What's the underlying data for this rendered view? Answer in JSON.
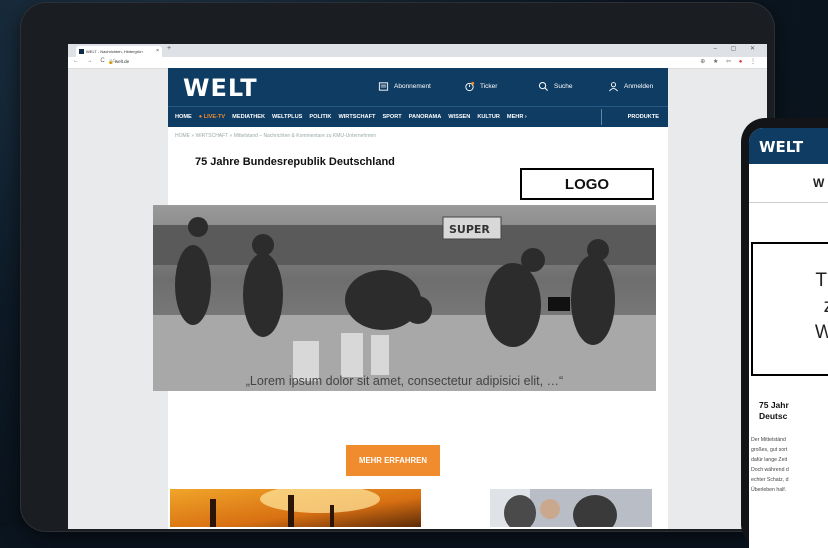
{
  "browser": {
    "tab_title": "WELT - Nachrichten, Hintergrün",
    "tab_close": "×",
    "new_tab": "+",
    "window_controls": "–  ▢  ✕",
    "nav_arrows": "← → C ⌂",
    "url": "welt.de"
  },
  "site": {
    "logo": "WELT",
    "header_items": [
      {
        "label": "Abonnement",
        "icon": "newspaper-icon"
      },
      {
        "label": "Ticker",
        "icon": "ticker-icon"
      },
      {
        "label": "Suche",
        "icon": "search-icon"
      },
      {
        "label": "Anmelden",
        "icon": "user-icon"
      }
    ],
    "nav": [
      "HOME",
      "● LIVE-TV",
      "MEDIATHEK",
      "WELTPLUS",
      "POLITIK",
      "WIRTSCHAFT",
      "SPORT",
      "PANORAMA",
      "WISSEN",
      "KULTUR",
      "MEHR ›",
      "PRODUKTE"
    ],
    "breadcrumb": "HOME » WIRTSCHAFT » Mittelstand – Nachrichten & Kommentare zu KMU-Unternehmen",
    "headline": "75 Jahre Bundesrepublik Deutschland",
    "logo_placeholder": "LOGO",
    "quote": "„Lorem ipsum dolor sit amet, consectetur adipisici elit, …“",
    "cta": "MEHR ERFAHREN"
  },
  "phone": {
    "logo": "WELT",
    "title_fragment": "W",
    "overlay_lines": [
      "T",
      "zuf",
      "We"
    ],
    "small_label": "WIRTSCHAFT",
    "headline_lines": [
      "75 Jahr",
      "Deutsc"
    ],
    "body_lines": [
      "Der Mittelständ",
      "großes, gut sort",
      "dafür lange Zeit",
      "Doch während d",
      "echter Schatz, d",
      "Überleben half."
    ]
  },
  "colors": {
    "brand_navy": "#0f3c63",
    "accent_orange": "#f08c2e"
  }
}
